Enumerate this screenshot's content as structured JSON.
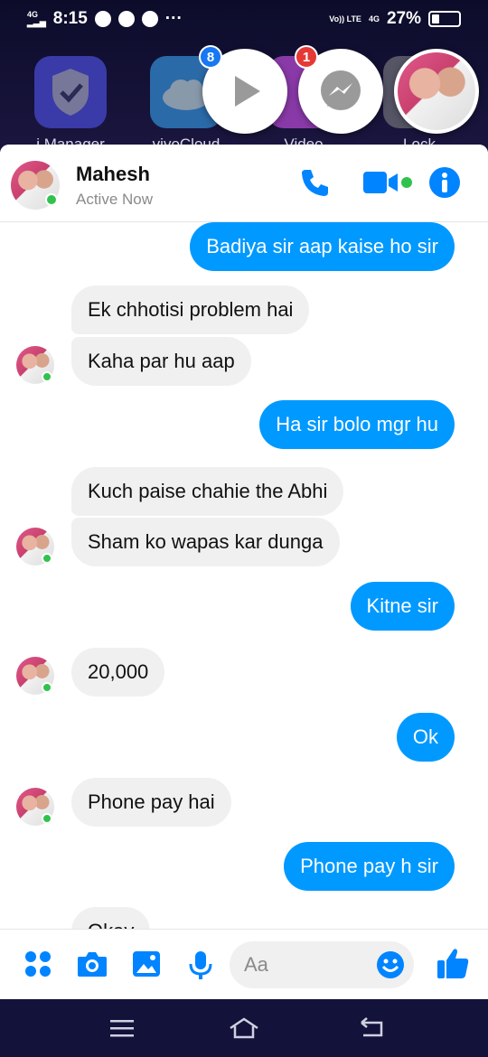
{
  "status_bar": {
    "network": "4G",
    "time": "8:15",
    "volte": "Vo)) LTE",
    "network_right": "4G",
    "battery": "27%",
    "battery_level": 0.27
  },
  "home_apps": [
    {
      "label": "i Manager",
      "color": "#3a3aa8"
    },
    {
      "label": "vivoCloud",
      "color": "#2a6aa8"
    },
    {
      "label": "Video",
      "color": "#8a3aa8"
    },
    {
      "label": "Lock",
      "color": "#555566"
    }
  ],
  "chat_heads": [
    {
      "badge": "8",
      "badge_color": "#1877f2",
      "icon": "play-icon"
    },
    {
      "badge": "1",
      "badge_color": "#e53935",
      "icon": "messenger-icon"
    },
    {
      "icon": "contact-avatar"
    }
  ],
  "header": {
    "name": "Mahesh",
    "status": "Active Now",
    "accent": "#0084ff"
  },
  "messages": [
    {
      "dir": "out",
      "text": "Badiya sir aap kaise ho sir"
    },
    {
      "dir": "in",
      "text": "Ek chhotisi problem hai"
    },
    {
      "dir": "in",
      "text": "Kaha par hu aap"
    },
    {
      "dir": "out",
      "text": "Ha sir bolo mgr hu"
    },
    {
      "dir": "in",
      "text": "Kuch paise chahie the Abhi"
    },
    {
      "dir": "in",
      "text": "Sham ko wapas kar dunga"
    },
    {
      "dir": "out",
      "text": "Kitne sir"
    },
    {
      "dir": "in",
      "text": "20,000"
    },
    {
      "dir": "out",
      "text": "Ok"
    },
    {
      "dir": "in",
      "text": "Phone pay hai"
    },
    {
      "dir": "out",
      "text": "Phone pay h sir"
    },
    {
      "dir": "in",
      "text": "Okay"
    }
  ],
  "composer": {
    "placeholder": "Aa"
  }
}
